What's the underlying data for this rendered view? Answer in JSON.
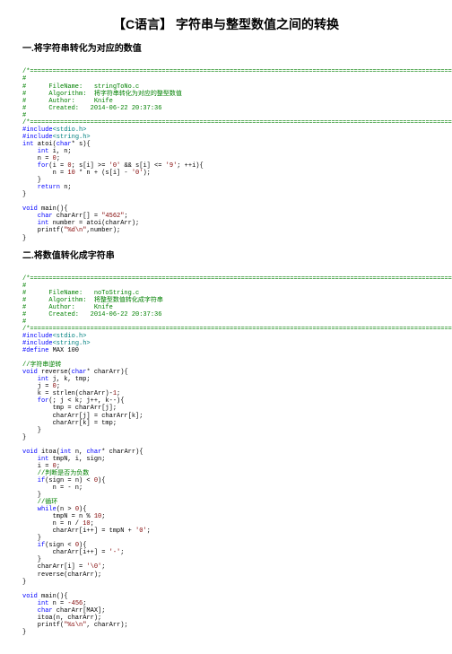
{
  "title": "【C语言】 字符串与整型数值之间的转换",
  "section1": {
    "heading": "一.将字符串转化为对应的数值",
    "hdr_line": "/*============================================================================================================================*/",
    "hdr_filename_lbl": "#      FileName:   ",
    "hdr_filename_val": "stringToNo.c",
    "hdr_algo_lbl": "#      Algorithm:  ",
    "hdr_algo_val": "将字符串转化为对应的整型数值",
    "hdr_author_lbl": "#      Author:     ",
    "hdr_author_val": "Knife",
    "hdr_created_lbl": "#      Created:   ",
    "hdr_created_val": "2014-06-22 20:37:36",
    "hash": "#",
    "inc1a": "#include",
    "inc1b": "<stdio.h>",
    "inc2b": "<string.h>",
    "int": "int",
    "atoi": " atoi(",
    "char": "char",
    "star_s": "* s){",
    "decl_in": "    int",
    "in": " i, n;",
    "n0": "    n = ",
    "zero": "0",
    "semi": ";",
    "for": "    for",
    "for_cond1": "(i = ",
    "for_cond2": "; s[i] >= ",
    "q0": "'0'",
    "for_cond3": " && s[i] <= ",
    "q9": "'9'",
    "for_cond4": "; ++i){",
    "body1": "        n = ",
    "ten": "10",
    "body2": " * n + (s[i] - ",
    "body3": ");",
    "cbrace": "    }",
    "ret": "    return",
    "retn": " n;",
    "rbrace": "}",
    "void": "void",
    "main": " main(){",
    "chararr": "    char",
    "chararr2": " charArr[] = ",
    "str4562": "\"4562\"",
    "numdecl": "    int",
    "numdecl2": " number = atoi(charArr);",
    "printf": "    printf(",
    "fmt1": "\"%d\\n\"",
    "printf2": ",number);"
  },
  "section2": {
    "heading": "二.将数值转化成字符串",
    "hdr_filename_val": "noToString.c",
    "hdr_algo_val": "将整型数值转化成字符串",
    "define": "#define",
    "max": " MAX 100",
    "cm_rev": "//字符串逆转",
    "rev_sig": " reverse(",
    "rev_sig2": "* charArr){",
    "decl_jktmp": " j, k, tmp;",
    "j0": "    j = ",
    "kline": "    k = strlen(charArr)-",
    "one": "1",
    "forrev": "(; j < k; j++, k--){",
    "tmp1": "        tmp = charArr[j];",
    "tmp2": "        charArr[j] = charArr[k];",
    "tmp3": "        charArr[k] = tmp;",
    "itoa_sig1": " itoa(",
    "itoa_sig2": " n, ",
    "itoa_sig3": "* charArr){",
    "decl_tis": " tmpN, i, sign;",
    "i0": "    i = ",
    "cm_neg": "    //判断是否为负数",
    "if": "    if",
    "ifco": "(sign = n) < ",
    "ifco2": "){",
    "negn": "        n = - n;",
    "cm_loop": "    //循环",
    "while": "    while",
    "whilec": "(n > ",
    "whilec2": "){",
    "tmpnline": "        tmpN = n % ",
    "ndiv": "        n = n / ",
    "arrline1": "        charArr[i++] = tmpN + ",
    "ifsign": "(sign < ",
    "minusline": "        charArr[i++] = ",
    "qminus": "'-'",
    "nullline": "    charArr[i] = ",
    "qnull": "'\\0'",
    "revcall": "    reverse(charArr);",
    "nval": " n = ",
    "n456": "-456",
    "chmax": " charArr[MAX];",
    "itoacall": "    itoa(n, charArr);",
    "fmt2": "\"%s\\n\"",
    "printf3": ", charArr);"
  }
}
